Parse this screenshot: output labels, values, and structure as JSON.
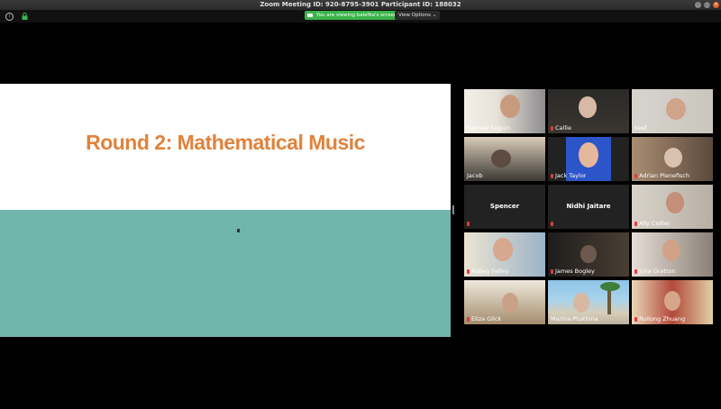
{
  "window": {
    "title": "Zoom Meeting ID: 920-8795-3901 Participant ID: 188032"
  },
  "toolbar": {
    "viewing_label": "You are viewing balefka's screen",
    "view_options_label": "View Options"
  },
  "slide": {
    "title": "Round 2: Mathematical Music",
    "top_color": "#ffffff",
    "bottom_color": "#6fb5ab",
    "title_color": "#e1823c"
  },
  "participants": [
    {
      "name": "Samuel Seguin",
      "muted": false
    },
    {
      "name": "Callie",
      "muted": true
    },
    {
      "name": "keef",
      "muted": false
    },
    {
      "name": "Jacob",
      "muted": false
    },
    {
      "name": "Jack Taylor",
      "muted": true
    },
    {
      "name": "Adrian Plenefisch",
      "muted": true
    },
    {
      "name": "Spencer",
      "muted": true,
      "video": false
    },
    {
      "name": "Nidhi Jaitare",
      "muted": true,
      "video": false
    },
    {
      "name": "Ally Collier",
      "muted": true
    },
    {
      "name": "Abbey Felley",
      "muted": true
    },
    {
      "name": "James Bogley",
      "muted": true
    },
    {
      "name": "Julia Gratton",
      "muted": true
    },
    {
      "name": "Eliza Glick",
      "muted": true
    },
    {
      "name": "Marina Ptukhina",
      "muted": false
    },
    {
      "name": "Ruilong Zhuang",
      "muted": true
    }
  ]
}
